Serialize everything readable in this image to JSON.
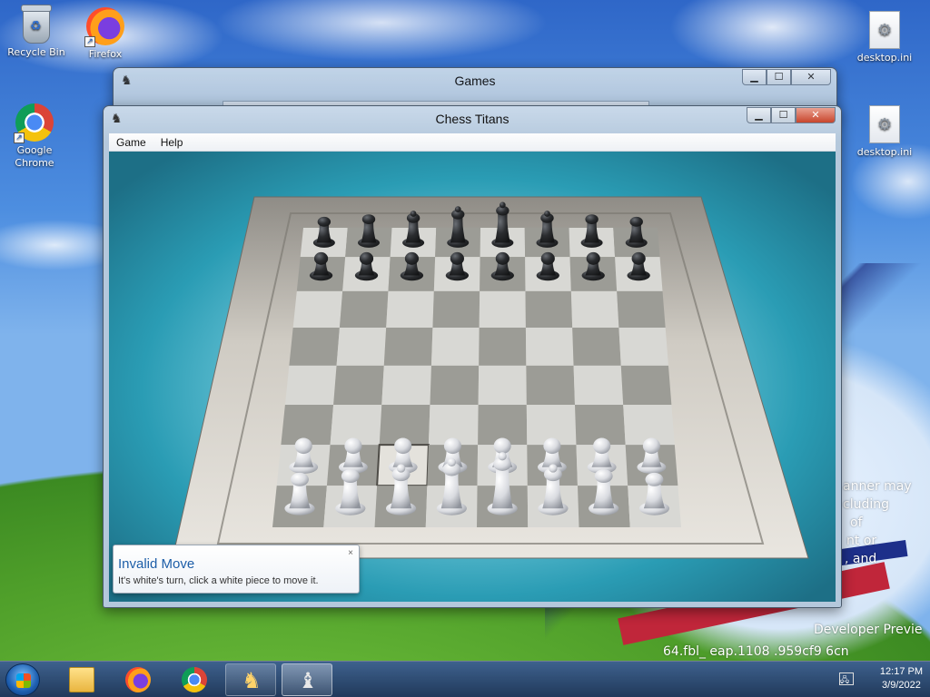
{
  "desktop": {
    "icons": [
      {
        "label": "Recycle Bin",
        "icon": "recycle-bin-icon"
      },
      {
        "label": "Firefox",
        "icon": "firefox-icon"
      },
      {
        "label": "Google Chrome",
        "icon": "chrome-icon"
      },
      {
        "label": "desktop.ini",
        "icon": "settings-file-icon"
      },
      {
        "label": "desktop.ini",
        "icon": "settings-file-icon"
      }
    ],
    "wallpaper_text": {
      "line1": "anner may",
      "line2": "cluding",
      "line3": "of",
      "line4": "nt or",
      "line5": ", and",
      "line6": "Developer Previe",
      "line7": "64.fbl_    eap.1108   .959cf9    6cn"
    }
  },
  "games_window": {
    "title": "Games",
    "controls": {
      "minimize": "▁",
      "maximize": "☐",
      "close": "✕"
    }
  },
  "chess_window": {
    "title": "Chess Titans",
    "controls": {
      "minimize": "▁",
      "maximize": "☐",
      "close": "✕"
    },
    "menu": [
      {
        "label": "Game"
      },
      {
        "label": "Help"
      }
    ],
    "board": {
      "files": 8,
      "ranks": 8,
      "black_back_rank": [
        "rook",
        "knight",
        "bishop",
        "queen",
        "king",
        "bishop",
        "knight",
        "rook"
      ],
      "white_back_rank": [
        "rook",
        "knight",
        "bishop",
        "queen",
        "king",
        "bishop",
        "knight",
        "rook"
      ],
      "highlighted_square": {
        "file": 2,
        "rank": 6
      },
      "colors": {
        "light_square": "#d8d8d4",
        "dark_square": "#9c9c96",
        "frame": "#b9b6ae",
        "black_piece": "#2b2d30",
        "white_piece": "#d9dbe0"
      }
    }
  },
  "notification": {
    "title": "Invalid Move",
    "body": "It's white's turn, click a white piece to move it.",
    "close": "×"
  },
  "taskbar": {
    "clock_time": "12:17 PM",
    "clock_date": "3/9/2022",
    "pinned": [
      {
        "name": "windows-explorer",
        "icon": "folder-icon"
      },
      {
        "name": "firefox",
        "icon": "firefox-icon"
      },
      {
        "name": "chrome",
        "icon": "chrome-icon"
      },
      {
        "name": "games",
        "icon": "games-icon"
      },
      {
        "name": "chess-titans",
        "icon": "chess-icon"
      }
    ]
  }
}
